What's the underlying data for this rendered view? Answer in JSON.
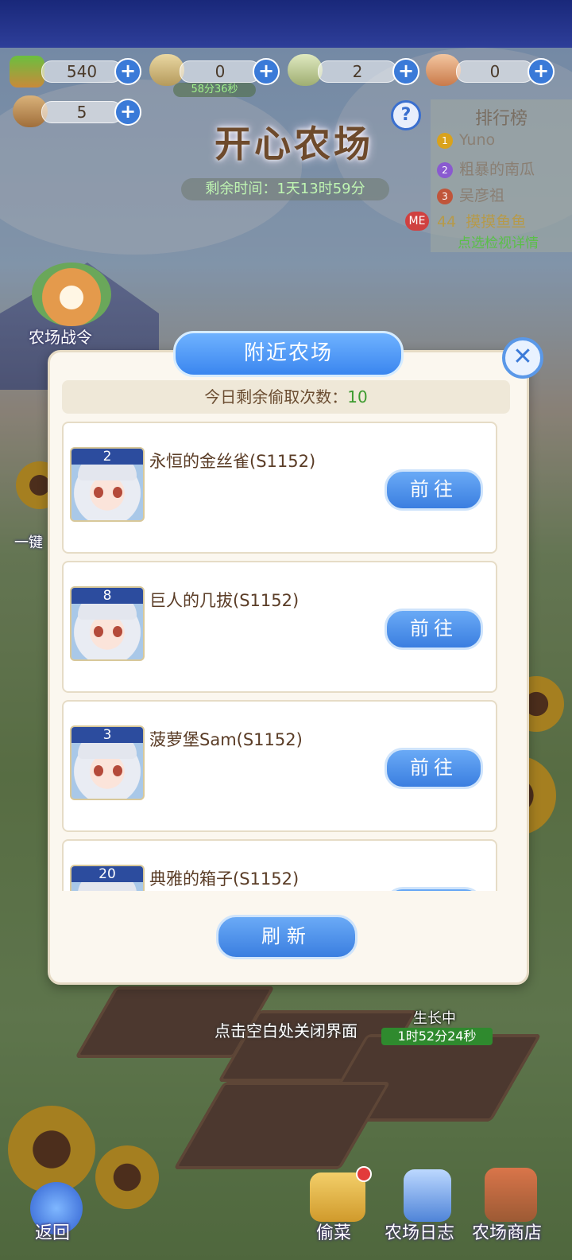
{
  "resources": [
    {
      "icon": "vegetable-crate-icon",
      "value": "540"
    },
    {
      "icon": "seed-bag-icon",
      "value": "0",
      "timer": "58分36秒"
    },
    {
      "icon": "fertilizer-bag-icon",
      "value": "2"
    },
    {
      "icon": "feed-sack-icon",
      "value": "0"
    },
    {
      "icon": "coin-sack-icon",
      "value": "5"
    }
  ],
  "title": "开心农场",
  "remaining_time": "剩余时间：1天13时59分",
  "help_symbol": "?",
  "ranking": {
    "title": "排行榜",
    "entries": [
      {
        "rank": "1",
        "name": "Yuno",
        "color": "#d9a21c"
      },
      {
        "rank": "2",
        "name": "粗暴的南瓜",
        "color": "#8a5ad0"
      },
      {
        "rank": "3",
        "name": "吴彦祖",
        "color": "#c0553a"
      }
    ],
    "me": {
      "badge": "ME",
      "rank": "44",
      "name": "摸摸鱼鱼"
    },
    "detail_link": "点选检视详情"
  },
  "side_buttons": {
    "battle_pass": "农场战令",
    "one_click": "一键"
  },
  "modal": {
    "title": "附近农场",
    "close_symbol": "✕",
    "steal_label": "今日剩余偷取次数：",
    "steal_count": "10",
    "farms": [
      {
        "level": "2",
        "name": "永恒的金丝雀(S1152)",
        "button": "前往"
      },
      {
        "level": "8",
        "name": "巨人的几拔(S1152)",
        "button": "前往"
      },
      {
        "level": "3",
        "name": "菠萝堡Sam(S1152)",
        "button": "前往"
      },
      {
        "level": "20",
        "name": "典雅的箱子(S1152)",
        "button": "前往"
      }
    ],
    "refresh": "刷新"
  },
  "close_hint": "点击空白处关闭界面",
  "growing": {
    "label": "生长中",
    "timer": "1时52分24秒"
  },
  "bottom_nav": {
    "back": "返回",
    "steal": "偷菜",
    "farm_log": "农场日志",
    "farm_shop": "农场商店"
  },
  "colors": {
    "accent_blue": "#3a7ee0",
    "steal_count_green": "#3d9b2f",
    "me_badge": "#d04040"
  }
}
